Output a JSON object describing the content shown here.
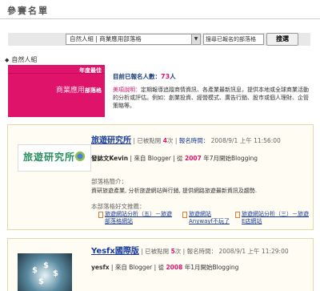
{
  "header": {
    "title": "參賽名單"
  },
  "filter": {
    "category_select": "自然人組 | 商業應用部落格",
    "search_value": "搜尋已報名的部落格",
    "search_button": "搜選"
  },
  "section": {
    "label": "自然人組"
  },
  "sidebar": {
    "year_label": "年度最佳",
    "category_main": "商業應用",
    "category_suffix": "部落格"
  },
  "info": {
    "count_label": "目前已報名人數：",
    "count_value": "73",
    "count_unit": "人",
    "desc_prefix": "美項說明：",
    "desc_text": "定期報導追蹤商情資訊、各產業最新訊息，提供本地或全球商業活動的分析或評估。例如：創業投資、經營模式、廣告行銷、股市或個人理財、企管策略等。"
  },
  "entries": [
    {
      "logo_text": "旅遊研究所",
      "title": "旅遊研究所",
      "votes_label": "已被點閱",
      "votes": "4",
      "votes_unit": "次",
      "signup_label": "報名時間：",
      "signup_time": "2008/9/1 上午 11:56:00",
      "author": "發誌文Kevin",
      "source_prefix": "來自 Blogger",
      "since_prefix": "從",
      "since_year": "2007",
      "since_year_unit": "年",
      "since_month": "7月開始Blogging",
      "intro_title": "部落格簡介：",
      "intro_text": "資研旅遊產業, 分析旅遊網站與行銷, 提供網路旅遊最新資訊及趨勢.",
      "articles_title": "本部落格好文推薦：",
      "articles": [
        "旅遊網站分析（五）－旅遊部落格網站",
        "旅遊網站Anywayf不玩了",
        "旅遊網站分析（三）－旅遊E店網站"
      ]
    },
    {
      "title": "Yesfx國際版",
      "votes_label": "已被點閱",
      "votes": "5",
      "votes_unit": "次",
      "signup_label": "報名時間：",
      "signup_time": "2008/9/1 上午 11:29:00",
      "author": "yesfx",
      "source_prefix": "來自 Blogger",
      "since_prefix": "從",
      "since_year": "2008",
      "since_year_unit": "年",
      "since_month": "1月開始Blogging"
    }
  ],
  "colors": {
    "accent": "#e0136b",
    "link": "#1a3a9a",
    "card_bg": "#fffdf3"
  }
}
